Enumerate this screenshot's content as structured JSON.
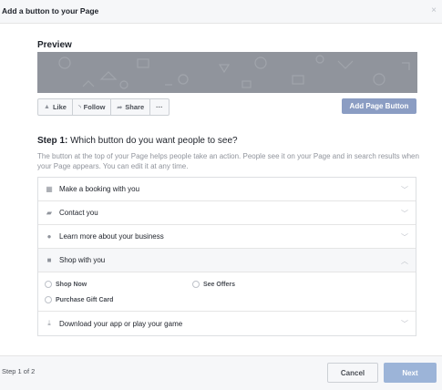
{
  "dialog": {
    "title": "Add a button to your Page",
    "close_glyph": "×"
  },
  "preview": {
    "label": "Preview",
    "page_buttons": [
      {
        "label": "Like",
        "icon": "thumbs-up-icon",
        "glyph": "👍"
      },
      {
        "label": "Follow",
        "icon": "rss-icon",
        "glyph": "〰"
      },
      {
        "label": "Share",
        "icon": "share-icon",
        "glyph": "➦"
      },
      {
        "label": "···",
        "icon": "more-icon",
        "glyph": ""
      }
    ],
    "add_button_label": "Add Page Button"
  },
  "step": {
    "title_prefix": "Step 1:",
    "title_rest": " Which button do you want people to see?",
    "description": "The button at the top of your Page helps people take an action. People see it on your Page and in search results when your Page appears. You can edit it at any time."
  },
  "options": [
    {
      "label": "Make a booking with you",
      "icon": "calendar-icon",
      "glyph": "▦",
      "chevron": "﹀"
    },
    {
      "label": "Contact you",
      "icon": "message-icon",
      "glyph": "▰",
      "chevron": "﹀"
    },
    {
      "label": "Learn more about your business",
      "icon": "info-icon",
      "glyph": "●",
      "chevron": "﹀"
    },
    {
      "label": "Shop with you",
      "icon": "shopping-bag-icon",
      "glyph": "■",
      "chevron": "︿"
    },
    {
      "label": "Download your app or play your game",
      "icon": "download-icon",
      "glyph": "⤓",
      "chevron": "﹀"
    }
  ],
  "shop_suboptions": [
    "Shop Now",
    "See Offers",
    "Purchase Gift Card"
  ],
  "footer": {
    "step_count": "Step 1 of 2",
    "cancel_label": "Cancel",
    "next_label": "Next"
  },
  "colors": {
    "cover": "#90949c",
    "add_button": "#8b9dc3",
    "next_button": "#9cb4d8"
  }
}
